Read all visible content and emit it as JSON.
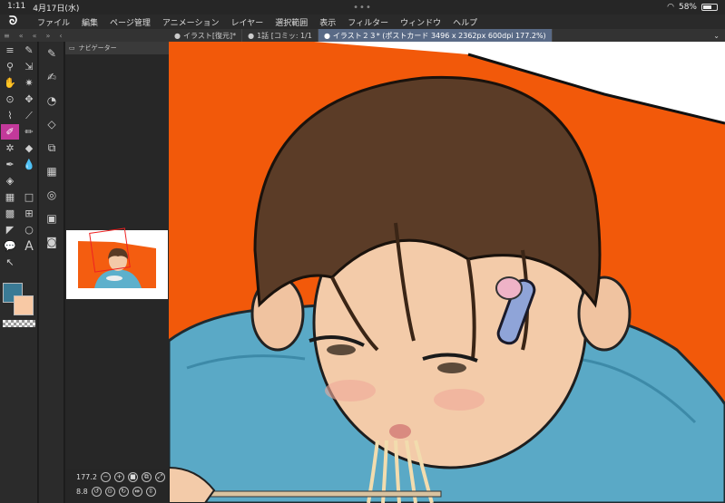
{
  "status_bar": {
    "time": "1:11",
    "date": "4月17日(水)",
    "battery": "58%"
  },
  "menu": [
    "ファイル",
    "編集",
    "ページ管理",
    "アニメーション",
    "レイヤー",
    "選択範囲",
    "表示",
    "フィルター",
    "ウィンドウ",
    "ヘルプ"
  ],
  "tabs": [
    {
      "label": "イラスト[復元]*",
      "active": false
    },
    {
      "label": "1話 [コミッ: 1/1",
      "active": false
    },
    {
      "label": "イラスト２３* (ポストカード 3496 x 2362px 600dpi 177.2%)",
      "active": true
    }
  ],
  "navigator": {
    "title": "ナビゲーター",
    "zoom": "177.2",
    "rotation": "8.8"
  },
  "colors": {
    "main": "#3a7a95",
    "sub": "#f8c9a5",
    "canvas_bg": "#f2590a",
    "active_tool": "#c2399a"
  },
  "tools": [
    "magnifier-icon",
    "move-layer-icon",
    "hand-icon",
    "sparkle-icon",
    "select-icon",
    "operation-icon",
    "lasso-icon",
    "eyedropper-icon",
    "pen-icon",
    "pencil-icon",
    "brush-icon",
    "eraser-icon",
    "airbrush-icon",
    "blend-icon",
    "fill-icon",
    "",
    "gradient-icon",
    "rect-icon",
    "frame-icon",
    "ellipse-icon",
    "balloon-icon",
    "text-icon",
    "correction-icon",
    ""
  ]
}
